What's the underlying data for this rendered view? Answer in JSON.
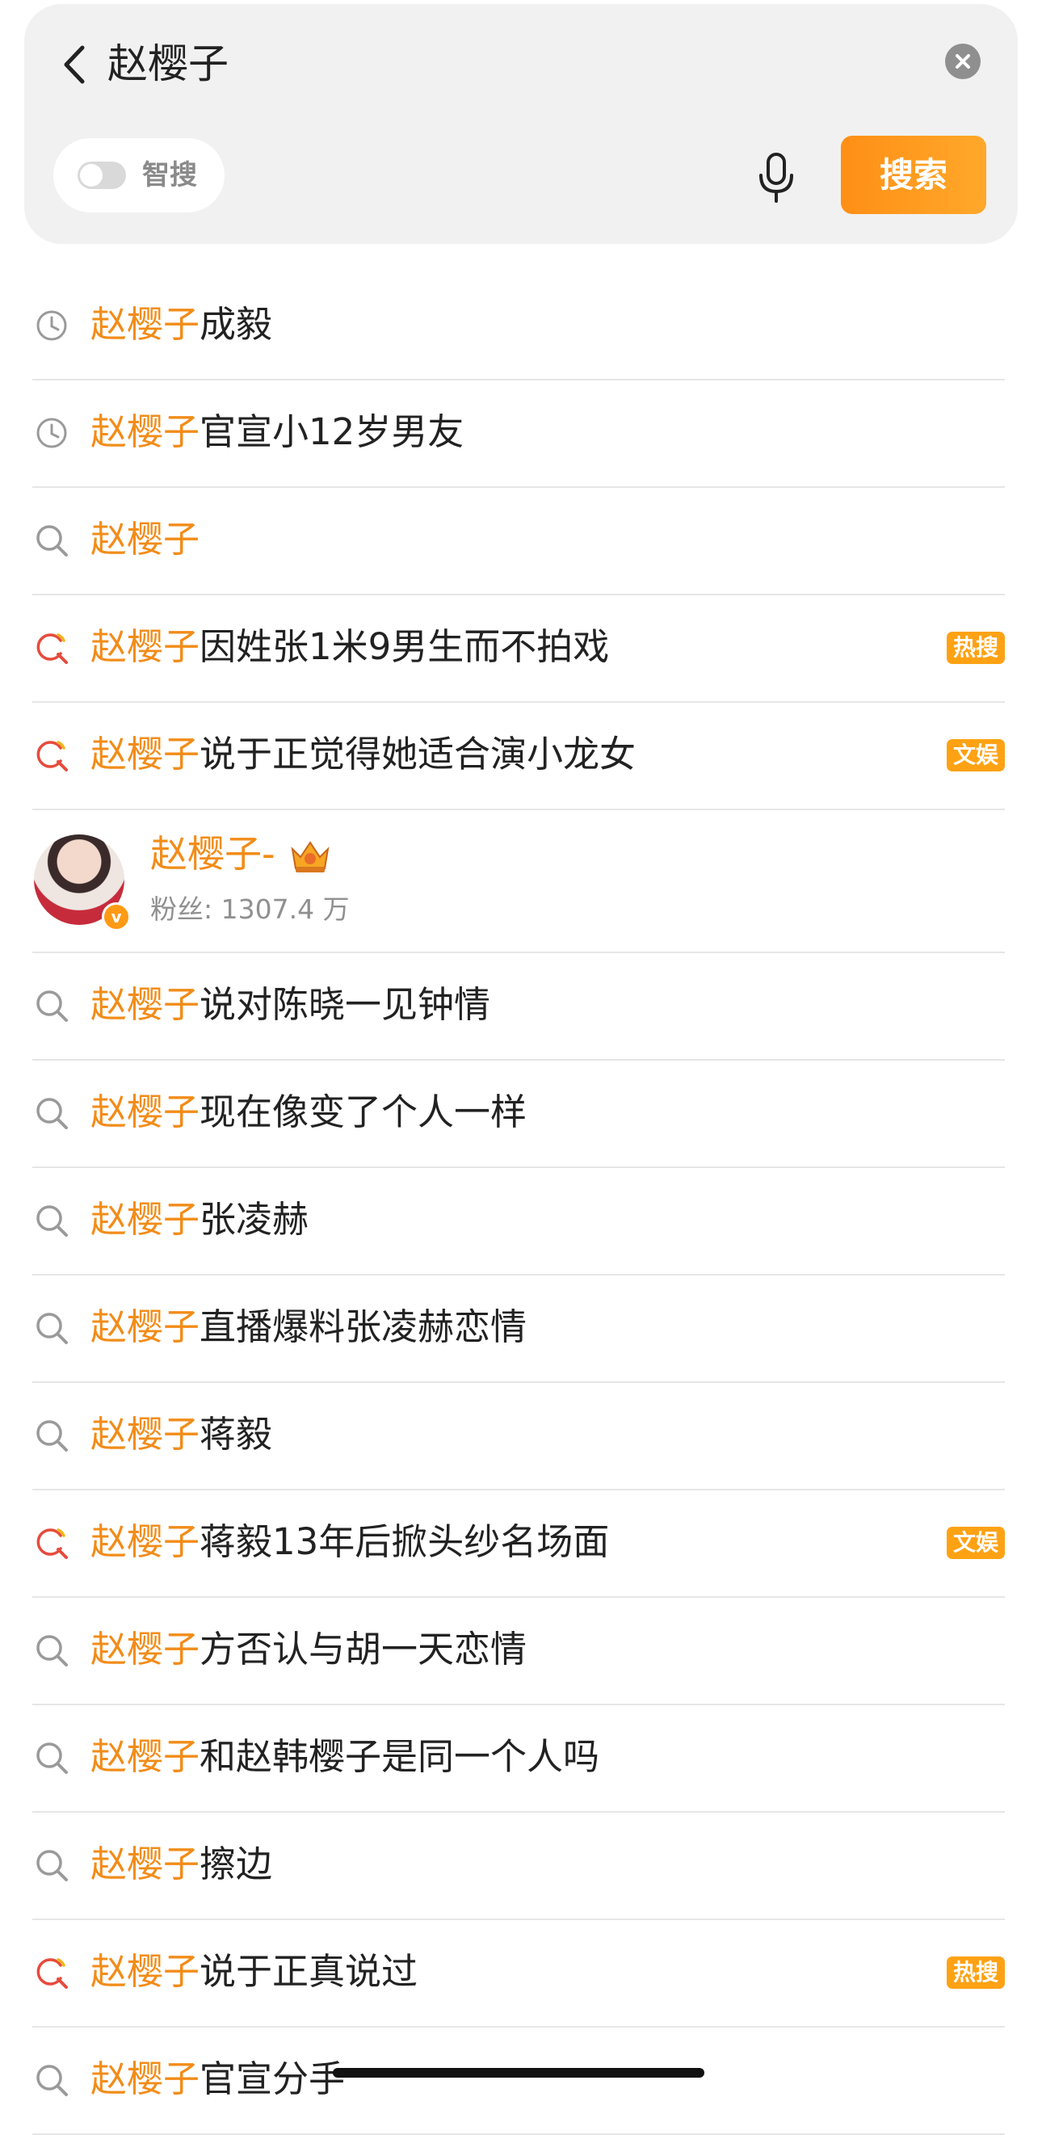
{
  "search": {
    "query": "赵樱子",
    "toggle_label": "智搜",
    "button_label": "搜索"
  },
  "keyword": "赵樱子",
  "colors": {
    "keyword": "#f28c19",
    "badge": "#fea214",
    "search_button": "#ff9a1f"
  },
  "items": [
    {
      "type": "history",
      "icon": "clock-icon",
      "kw": "赵樱子",
      "rest": "成毅",
      "badge": ""
    },
    {
      "type": "history",
      "icon": "clock-icon",
      "kw": "赵樱子",
      "rest": "官宣小12岁男友",
      "badge": ""
    },
    {
      "type": "suggest",
      "icon": "search-icon",
      "kw": "赵樱子",
      "rest": "",
      "badge": ""
    },
    {
      "type": "hot",
      "icon": "hot-search-icon",
      "kw": "赵樱子",
      "rest": "因姓张1米9男生而不拍戏",
      "badge": "热搜"
    },
    {
      "type": "hot",
      "icon": "hot-search-icon",
      "kw": "赵樱子",
      "rest": "说于正觉得她适合演小龙女",
      "badge": "文娱"
    },
    {
      "type": "suggest",
      "icon": "search-icon",
      "kw": "赵樱子",
      "rest": "说对陈晓一见钟情",
      "badge": ""
    },
    {
      "type": "suggest",
      "icon": "search-icon",
      "kw": "赵樱子",
      "rest": "现在像变了个人一样",
      "badge": ""
    },
    {
      "type": "suggest",
      "icon": "search-icon",
      "kw": "赵樱子",
      "rest": "张凌赫",
      "badge": ""
    },
    {
      "type": "suggest",
      "icon": "search-icon",
      "kw": "赵樱子",
      "rest": "直播爆料张凌赫恋情",
      "badge": ""
    },
    {
      "type": "suggest",
      "icon": "search-icon",
      "kw": "赵樱子",
      "rest": "蒋毅",
      "badge": ""
    },
    {
      "type": "hot",
      "icon": "hot-search-icon",
      "kw": "赵樱子",
      "rest": "蒋毅13年后掀头纱名场面",
      "badge": "文娱"
    },
    {
      "type": "suggest",
      "icon": "search-icon",
      "kw": "赵樱子",
      "rest": "方否认与胡一天恋情",
      "badge": ""
    },
    {
      "type": "suggest",
      "icon": "search-icon",
      "kw": "赵樱子",
      "rest": "和赵韩樱子是同一个人吗",
      "badge": ""
    },
    {
      "type": "suggest",
      "icon": "search-icon",
      "kw": "赵樱子",
      "rest": "擦边",
      "badge": ""
    },
    {
      "type": "hot",
      "icon": "hot-search-icon",
      "kw": "赵樱子",
      "rest": "说于正真说过",
      "badge": "热搜"
    },
    {
      "type": "suggest",
      "icon": "search-icon",
      "kw": "赵樱子",
      "rest": "官宣分手",
      "badge": ""
    }
  ],
  "user": {
    "name": "赵樱子-",
    "fans": "粉丝: 1307.4 万",
    "verified_icon": "verified-badge-icon",
    "crown_icon": "crown-icon"
  }
}
